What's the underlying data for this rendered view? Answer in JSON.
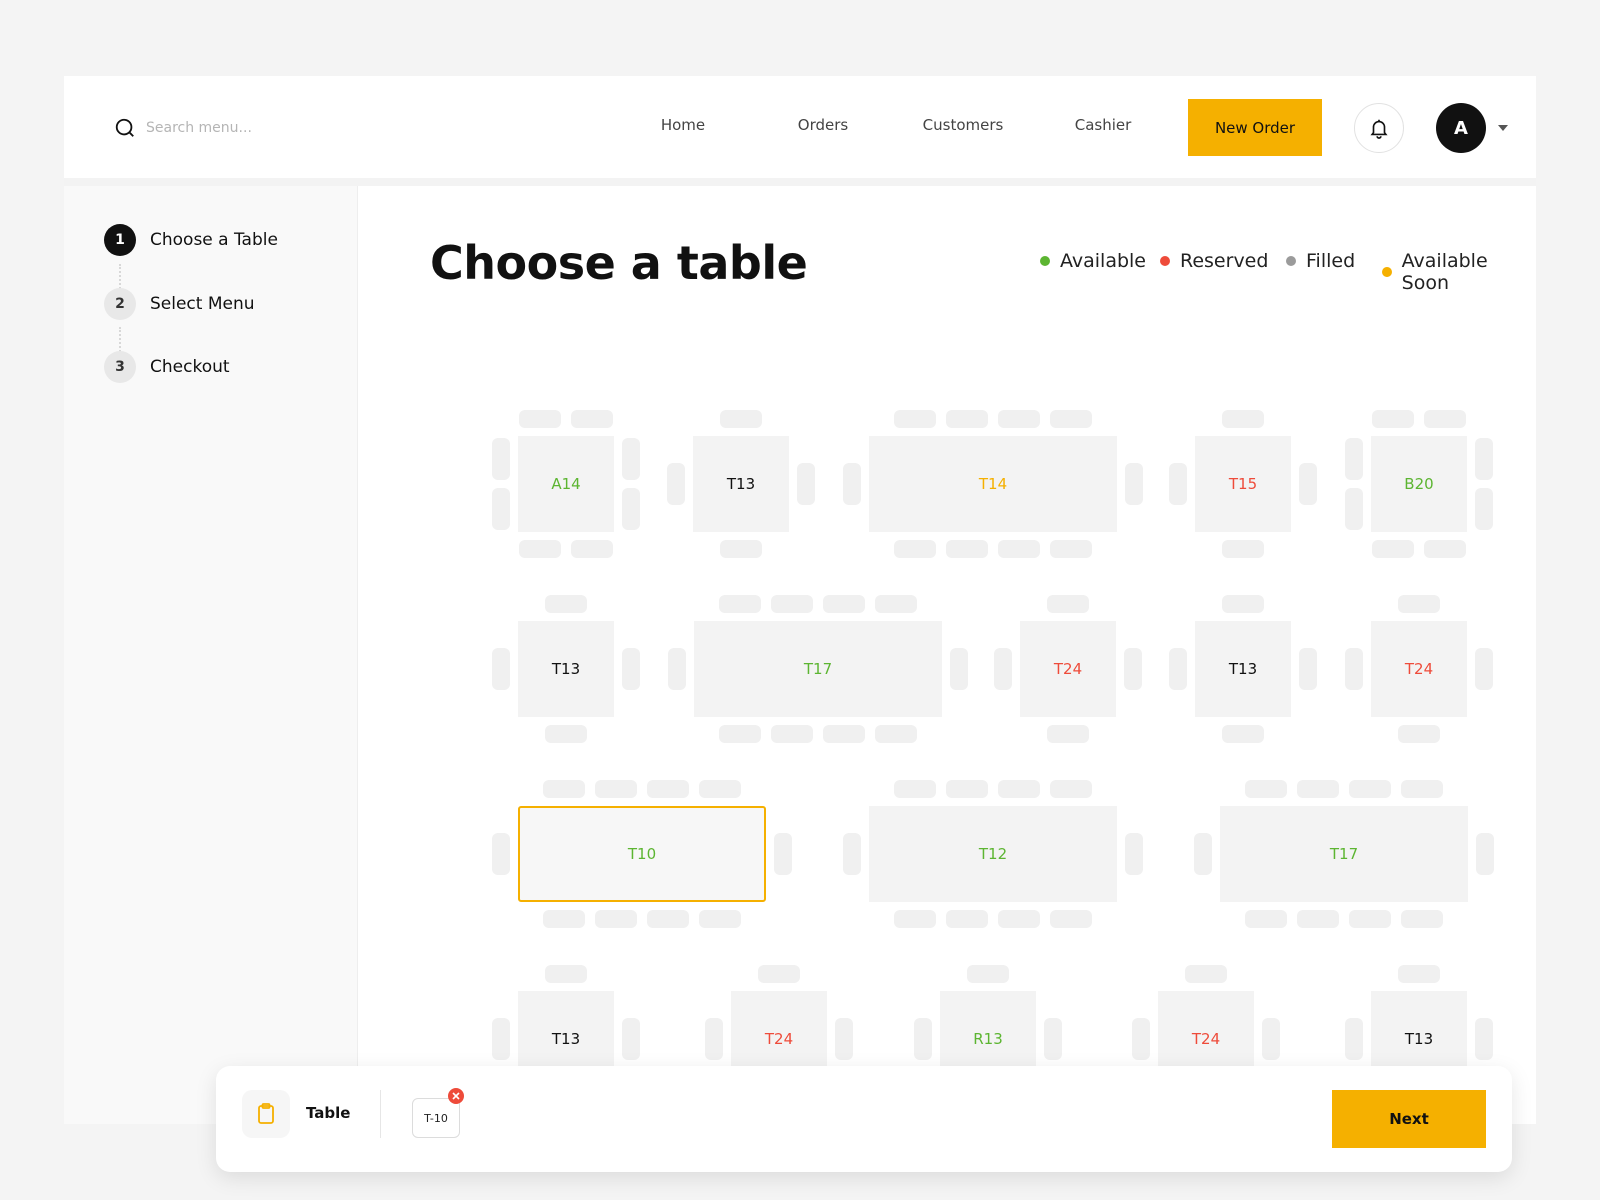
{
  "header": {
    "search_placeholder": "Search menu...",
    "nav": [
      "Home",
      "Orders",
      "Customers",
      "Cashier"
    ],
    "new_order_label": "New Order",
    "avatar_initial": "A"
  },
  "steps": [
    {
      "num": "1",
      "label": "Choose a Table",
      "active": true
    },
    {
      "num": "2",
      "label": "Select Menu",
      "active": false
    },
    {
      "num": "3",
      "label": "Checkout",
      "active": false
    }
  ],
  "main": {
    "title": "Choose a table",
    "legend": [
      {
        "label": "Available",
        "color": "#5cb531"
      },
      {
        "label": "Reserved",
        "color": "#ee4b3a"
      },
      {
        "label": "Filled",
        "color": "#9b9b9b"
      },
      {
        "label": "Available Soon",
        "color": "#f5b000"
      }
    ]
  },
  "status_colors": {
    "available": "#5cb531",
    "reserved": "#ee4b3a",
    "filled": "#111111",
    "soon": "#f5b000"
  },
  "tables": [
    {
      "label": "A14",
      "status": "available",
      "shape": "square4"
    },
    {
      "label": "T13",
      "status": "filled",
      "shape": "square2"
    },
    {
      "label": "T14",
      "status": "soon",
      "shape": "long"
    },
    {
      "label": "T15",
      "status": "reserved",
      "shape": "square2"
    },
    {
      "label": "B20",
      "status": "available",
      "shape": "square4"
    },
    {
      "label": "T13",
      "status": "filled",
      "shape": "square2"
    },
    {
      "label": "T17",
      "status": "available",
      "shape": "long"
    },
    {
      "label": "T24",
      "status": "reserved",
      "shape": "square2"
    },
    {
      "label": "T13",
      "status": "filled",
      "shape": "square2"
    },
    {
      "label": "T24",
      "status": "reserved",
      "shape": "square2"
    },
    {
      "label": "T10",
      "status": "available",
      "shape": "long",
      "selected": true
    },
    {
      "label": "T12",
      "status": "available",
      "shape": "long"
    },
    {
      "label": "T17",
      "status": "available",
      "shape": "long"
    },
    {
      "label": "T13",
      "status": "filled",
      "shape": "square2"
    },
    {
      "label": "T24",
      "status": "reserved",
      "shape": "square2"
    },
    {
      "label": "R13",
      "status": "available",
      "shape": "square2"
    },
    {
      "label": "T24",
      "status": "reserved",
      "shape": "square2"
    },
    {
      "label": "T13",
      "status": "filled",
      "shape": "square2"
    }
  ],
  "bottom_bar": {
    "label": "Table",
    "selected_chip": "T-10",
    "next_label": "Next"
  }
}
